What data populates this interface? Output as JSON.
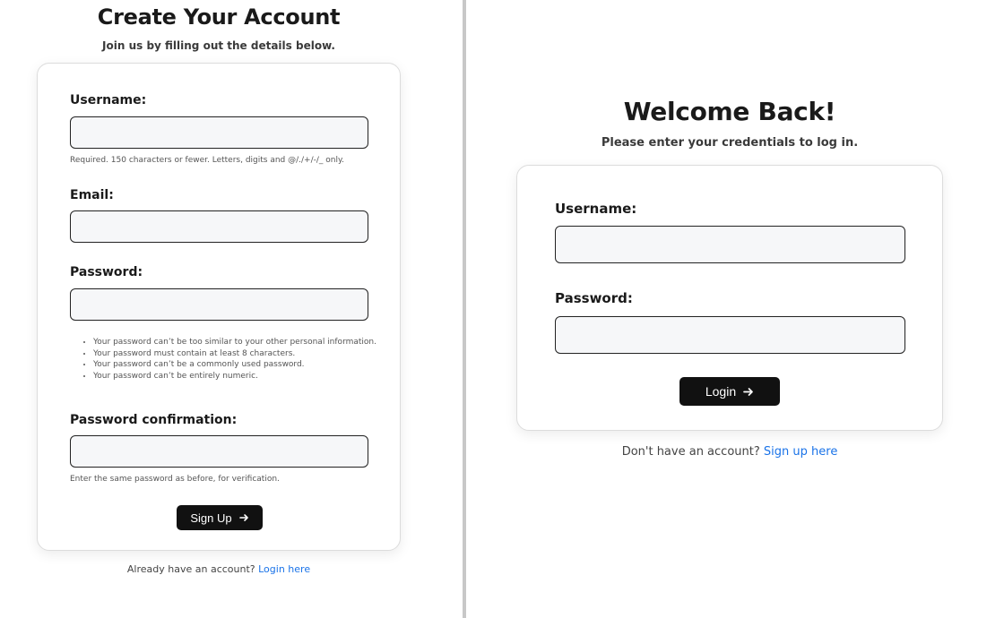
{
  "signup": {
    "title": "Create Your Account",
    "subtitle": "Join us by filling out the details below.",
    "username_label": "Username:",
    "username_help": "Required. 150 characters or fewer. Letters, digits and @/./+/-/_ only.",
    "email_label": "Email:",
    "password_label": "Password:",
    "password_rules": [
      "Your password can’t be too similar to your other personal information.",
      "Your password must contain at least 8 characters.",
      "Your password can’t be a commonly used password.",
      "Your password can’t be entirely numeric."
    ],
    "password_confirm_label": "Password confirmation:",
    "password_confirm_help": "Enter the same password as before, for verification.",
    "button_label": "Sign Up",
    "button_icon": "arrow-right-icon",
    "footer_text": "Already have an account?",
    "footer_link": "Login here"
  },
  "login": {
    "title": "Welcome Back!",
    "subtitle": "Please enter your credentials to log in.",
    "username_label": "Username:",
    "password_label": "Password:",
    "button_label": "Login",
    "button_icon": "arrow-right-icon",
    "footer_text": "Don't have an account?",
    "footer_link": "Sign up here"
  },
  "colors": {
    "button": "#111111",
    "link": "#1a73e8",
    "input_bg": "#f6f7f9",
    "divider": "#c8c8c8"
  }
}
